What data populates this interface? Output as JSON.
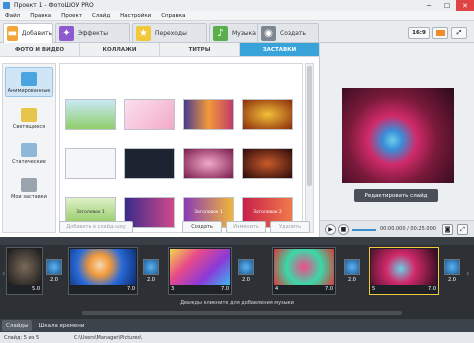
{
  "window": {
    "title": "Проект 1 - ФотоШОУ PRO",
    "minimize": "─",
    "maximize": "☐",
    "close": "✕"
  },
  "menu": [
    "Файл",
    "Правка",
    "Проект",
    "Слайд",
    "Настройки",
    "Справка"
  ],
  "main_tabs": [
    {
      "label": "Добавить",
      "icon": "folder-icon",
      "color": "#f2a53a"
    },
    {
      "label": "Эффекты",
      "icon": "effects-icon",
      "color": "#8d5ad0"
    },
    {
      "label": "Переходы",
      "icon": "star-icon",
      "color": "#f0c83a"
    },
    {
      "label": "Музыка",
      "icon": "music-icon",
      "color": "#5aaf4c"
    },
    {
      "label": "Создать",
      "icon": "disc-icon",
      "color": "#7d8791"
    }
  ],
  "aspect": {
    "ratio": "16:9"
  },
  "sub_tabs": [
    "ФОТО И ВИДЕО",
    "КОЛЛАЖИ",
    "ТИТРЫ",
    "ЗАСТАВКИ"
  ],
  "categories": [
    "Анимированные",
    "Светящиеся",
    "Статические",
    "Мои заставки"
  ],
  "gallery_captions": [
    "Заголовок 1",
    "Заголовок 1",
    "Заголовок 2",
    "Заголовок 2"
  ],
  "actions": {
    "add_to_show": "Добавить в слайд-шоу",
    "create": "Создать",
    "edit": "Изменить",
    "delete": "Удалить"
  },
  "preview": {
    "edit_label": "Редактировать слайд",
    "time": "00:00.000 / 00:25.000"
  },
  "timeline": {
    "slides": [
      {
        "num": "",
        "duration": "5.0"
      },
      {
        "num": "",
        "duration": "7.0"
      },
      {
        "num": "3",
        "duration": "7.0"
      },
      {
        "num": "4",
        "duration": "7.0"
      },
      {
        "num": "5",
        "duration": "7.0"
      }
    ],
    "transitions": [
      "2.0",
      "2.0",
      "2.0",
      "2.0",
      "2.0"
    ],
    "music_hint": "Дважды кликните для добавления музыки"
  },
  "bottom_tabs": [
    "Слайды",
    "Шкала времени"
  ],
  "status": {
    "slides": "Слайд: 5 из 5",
    "path": "C:\\Users\\Manager\\Pictures\\"
  }
}
